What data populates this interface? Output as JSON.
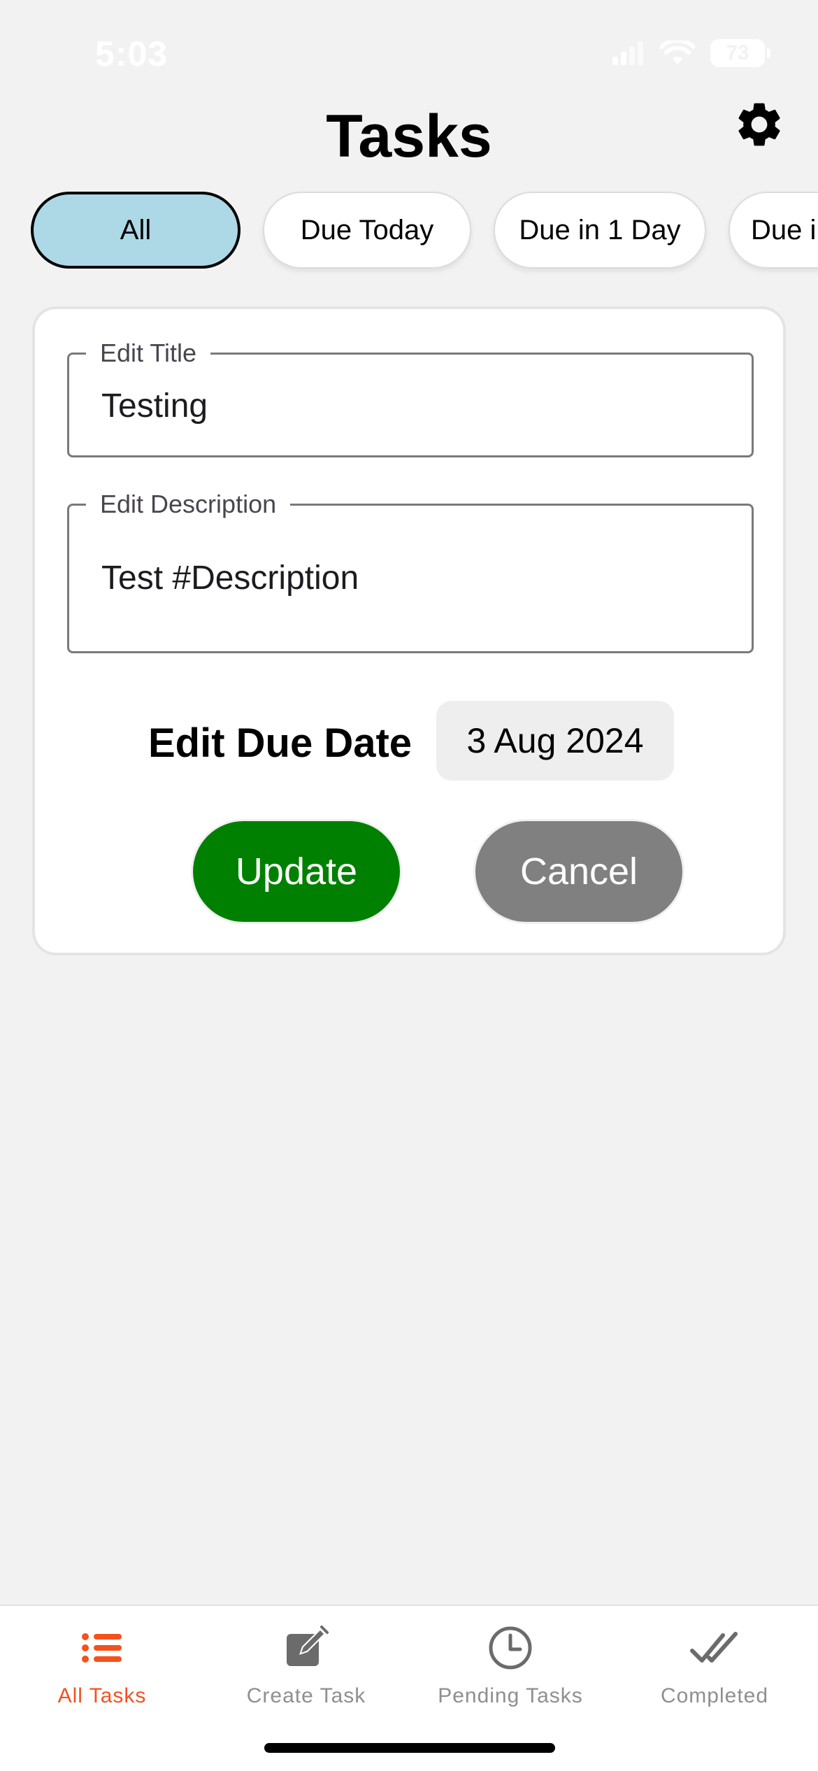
{
  "status_bar": {
    "time": "5:03",
    "battery": "73"
  },
  "header": {
    "title": "Tasks",
    "settings_icon": "gear-icon"
  },
  "filters": [
    {
      "label": "All",
      "active": true
    },
    {
      "label": "Due Today",
      "active": false
    },
    {
      "label": "Due in 1 Day",
      "active": false
    },
    {
      "label": "Due i",
      "active": false
    }
  ],
  "edit_form": {
    "title_label": "Edit Title",
    "title_value": "Testing",
    "description_label": "Edit Description",
    "description_value": "Test #Description",
    "due_date_label": "Edit Due Date",
    "due_date_value": "3 Aug 2024",
    "update_label": "Update",
    "cancel_label": "Cancel"
  },
  "tab_bar": {
    "items": [
      {
        "label": "All Tasks",
        "icon": "list-icon",
        "active": true
      },
      {
        "label": "Create Task",
        "icon": "edit-icon",
        "active": false
      },
      {
        "label": "Pending Tasks",
        "icon": "clock-icon",
        "active": false
      },
      {
        "label": "Completed",
        "icon": "double-check-icon",
        "active": false
      }
    ]
  },
  "colors": {
    "active_chip": "#add8e6",
    "update_button": "#008000",
    "cancel_button": "#808080",
    "active_tab": "#f4511e",
    "inactive_tab": "#8e8e93"
  }
}
